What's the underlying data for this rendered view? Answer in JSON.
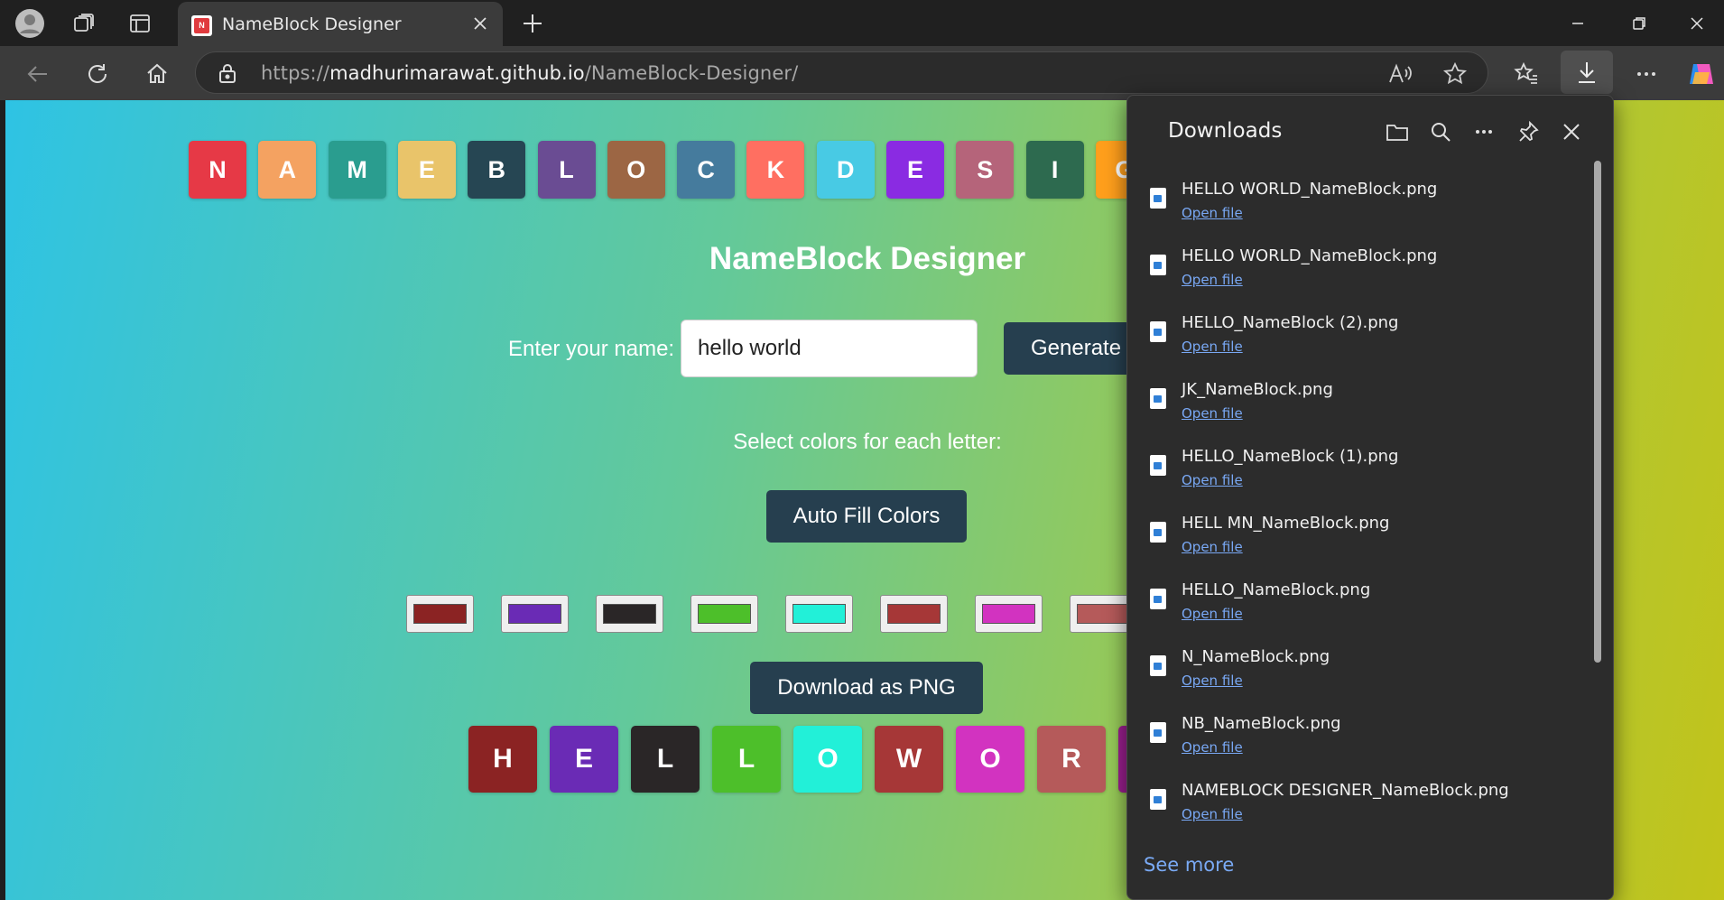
{
  "browser": {
    "tab_title": "NameBlock Designer",
    "tab_favicon_letter": "N",
    "url_scheme": "https://",
    "url_host": "madhurimarawat.github.io",
    "url_path": "/NameBlock-Designer/"
  },
  "page": {
    "banner_blocks": [
      {
        "letter": "N",
        "color": "#e63946"
      },
      {
        "letter": "A",
        "color": "#f4a261"
      },
      {
        "letter": "M",
        "color": "#2a9d8f"
      },
      {
        "letter": "E",
        "color": "#e9c46a"
      },
      {
        "letter": "B",
        "color": "#264653"
      },
      {
        "letter": "L",
        "color": "#6a4c93"
      },
      {
        "letter": "O",
        "color": "#9c6644"
      },
      {
        "letter": "C",
        "color": "#457b9d"
      },
      {
        "letter": "K",
        "color": "#ff6f61"
      },
      {
        "letter": "D",
        "color": "#48cae4"
      },
      {
        "letter": "E",
        "color": "#8a2be2"
      },
      {
        "letter": "S",
        "color": "#b5647a"
      },
      {
        "letter": "I",
        "color": "#2d6a4f"
      },
      {
        "letter": "G",
        "color": "#ff9f1c"
      }
    ],
    "heading": "NameBlock Designer",
    "name_label": "Enter your name:",
    "name_value": "hello world",
    "generate_label": "Generate",
    "select_colors_label": "Select colors for each letter:",
    "auto_fill_label": "Auto Fill Colors",
    "swatches": [
      "#8b2323",
      "#6a2bb5",
      "#2a2627",
      "#4dbf2a",
      "#22f0d8",
      "#a63737",
      "#d233c0",
      "#b55a5a"
    ],
    "download_label": "Download as PNG",
    "output_blocks": [
      {
        "letter": "H",
        "color": "#8b2323"
      },
      {
        "letter": "E",
        "color": "#6a2bb5"
      },
      {
        "letter": "L",
        "color": "#2a2627"
      },
      {
        "letter": "L",
        "color": "#4dbf2a"
      },
      {
        "letter": "O",
        "color": "#22f0d8"
      },
      {
        "letter": "W",
        "color": "#a63737"
      },
      {
        "letter": "O",
        "color": "#d233c0"
      },
      {
        "letter": "R",
        "color": "#b55a5a"
      },
      {
        "letter": "",
        "color": "#9b1f8f"
      }
    ]
  },
  "downloads": {
    "title": "Downloads",
    "open_label": "Open file",
    "see_more": "See more",
    "items": [
      "HELLO WORLD_NameBlock.png",
      "HELLO WORLD_NameBlock.png",
      "HELLO_NameBlock (2).png",
      "JK_NameBlock.png",
      "HELLO_NameBlock (1).png",
      "HELL MN_NameBlock.png",
      "HELLO_NameBlock.png",
      "N_NameBlock.png",
      "NB_NameBlock.png",
      "NAMEBLOCK DESIGNER_NameBlock.png"
    ]
  }
}
